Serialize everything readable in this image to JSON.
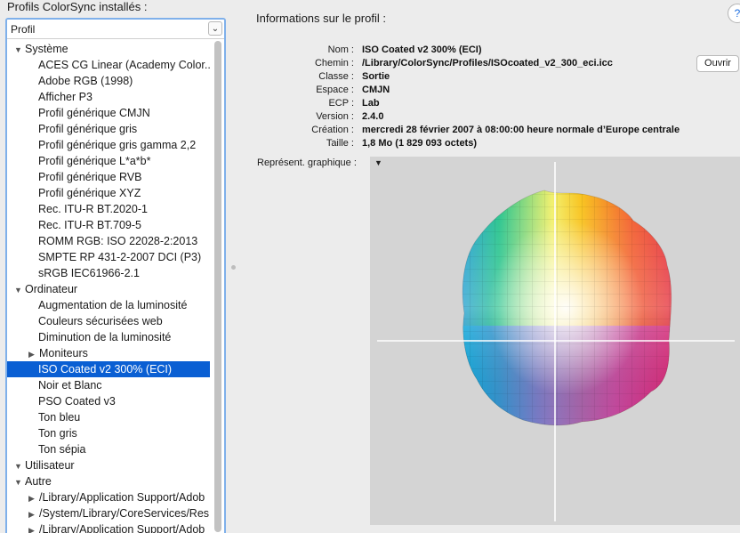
{
  "left": {
    "title": "Profils ColorSync installés :",
    "sort_value": "Profil",
    "tree": [
      {
        "label": "Système",
        "kind": "group",
        "expanded": true
      },
      {
        "label": "ACES CG Linear (Academy Color...",
        "kind": "leaf"
      },
      {
        "label": "Adobe RGB (1998)",
        "kind": "leaf"
      },
      {
        "label": "Afficher P3",
        "kind": "leaf"
      },
      {
        "label": "Profil générique CMJN",
        "kind": "leaf"
      },
      {
        "label": "Profil générique gris",
        "kind": "leaf"
      },
      {
        "label": "Profil générique gris gamma 2,2",
        "kind": "leaf"
      },
      {
        "label": "Profil générique L*a*b*",
        "kind": "leaf"
      },
      {
        "label": "Profil générique RVB",
        "kind": "leaf"
      },
      {
        "label": "Profil générique XYZ",
        "kind": "leaf"
      },
      {
        "label": "Rec. ITU-R BT.2020-1",
        "kind": "leaf"
      },
      {
        "label": "Rec. ITU-R BT.709-5",
        "kind": "leaf"
      },
      {
        "label": "ROMM RGB: ISO 22028-2:2013",
        "kind": "leaf"
      },
      {
        "label": "SMPTE RP 431-2-2007 DCI (P3)",
        "kind": "leaf"
      },
      {
        "label": "sRGB IEC61966-2.1",
        "kind": "leaf"
      },
      {
        "label": "Ordinateur",
        "kind": "group",
        "expanded": true
      },
      {
        "label": "Augmentation de la luminosité",
        "kind": "leaf"
      },
      {
        "label": "Couleurs sécurisées web",
        "kind": "leaf"
      },
      {
        "label": "Diminution de la luminosité",
        "kind": "leaf"
      },
      {
        "label": "Moniteurs",
        "kind": "subgroup",
        "expanded": false
      },
      {
        "label": "ISO Coated v2 300% (ECI)",
        "kind": "leaf",
        "selected": true
      },
      {
        "label": "Noir et Blanc",
        "kind": "leaf"
      },
      {
        "label": "PSO Coated v3",
        "kind": "leaf"
      },
      {
        "label": "Ton bleu",
        "kind": "leaf"
      },
      {
        "label": "Ton gris",
        "kind": "leaf"
      },
      {
        "label": "Ton sépia",
        "kind": "leaf"
      },
      {
        "label": "Utilisateur",
        "kind": "group",
        "expanded": true
      },
      {
        "label": "Autre",
        "kind": "group",
        "expanded": true
      },
      {
        "label": "/Library/Application Support/Adob",
        "kind": "subgroup",
        "expanded": false
      },
      {
        "label": "/System/Library/CoreServices/Res",
        "kind": "subgroup",
        "expanded": false
      },
      {
        "label": "/Library/Application Support/Adob",
        "kind": "subgroup",
        "expanded": false
      }
    ]
  },
  "info": {
    "title": "Informations sur le profil :",
    "help": "?",
    "open_button": "Ouvrir",
    "graph_label": "Représent. graphique :",
    "graph_menu": "▼",
    "properties": [
      {
        "key": "Nom :",
        "value": "ISO Coated v2 300% (ECI)"
      },
      {
        "key": "Chemin :",
        "value": "/Library/ColorSync/Profiles/ISOcoated_v2_300_eci.icc"
      },
      {
        "key": "Classe :",
        "value": "Sortie"
      },
      {
        "key": "Espace :",
        "value": "CMJN"
      },
      {
        "key": "ECP :",
        "value": "Lab"
      },
      {
        "key": "Version :",
        "value": "2.4.0"
      },
      {
        "key": "Création :",
        "value": "mercredi 28 février 2007 à 08:00:00 heure normale d’Europe centrale"
      },
      {
        "key": "Taille :",
        "value": "1,8 Mo (1 829 093 octets)"
      }
    ]
  },
  "colors": {
    "selection": "#0a5fd3",
    "focus_ring": "#7fb0ea",
    "graph_bg": "#d4d4d4"
  }
}
